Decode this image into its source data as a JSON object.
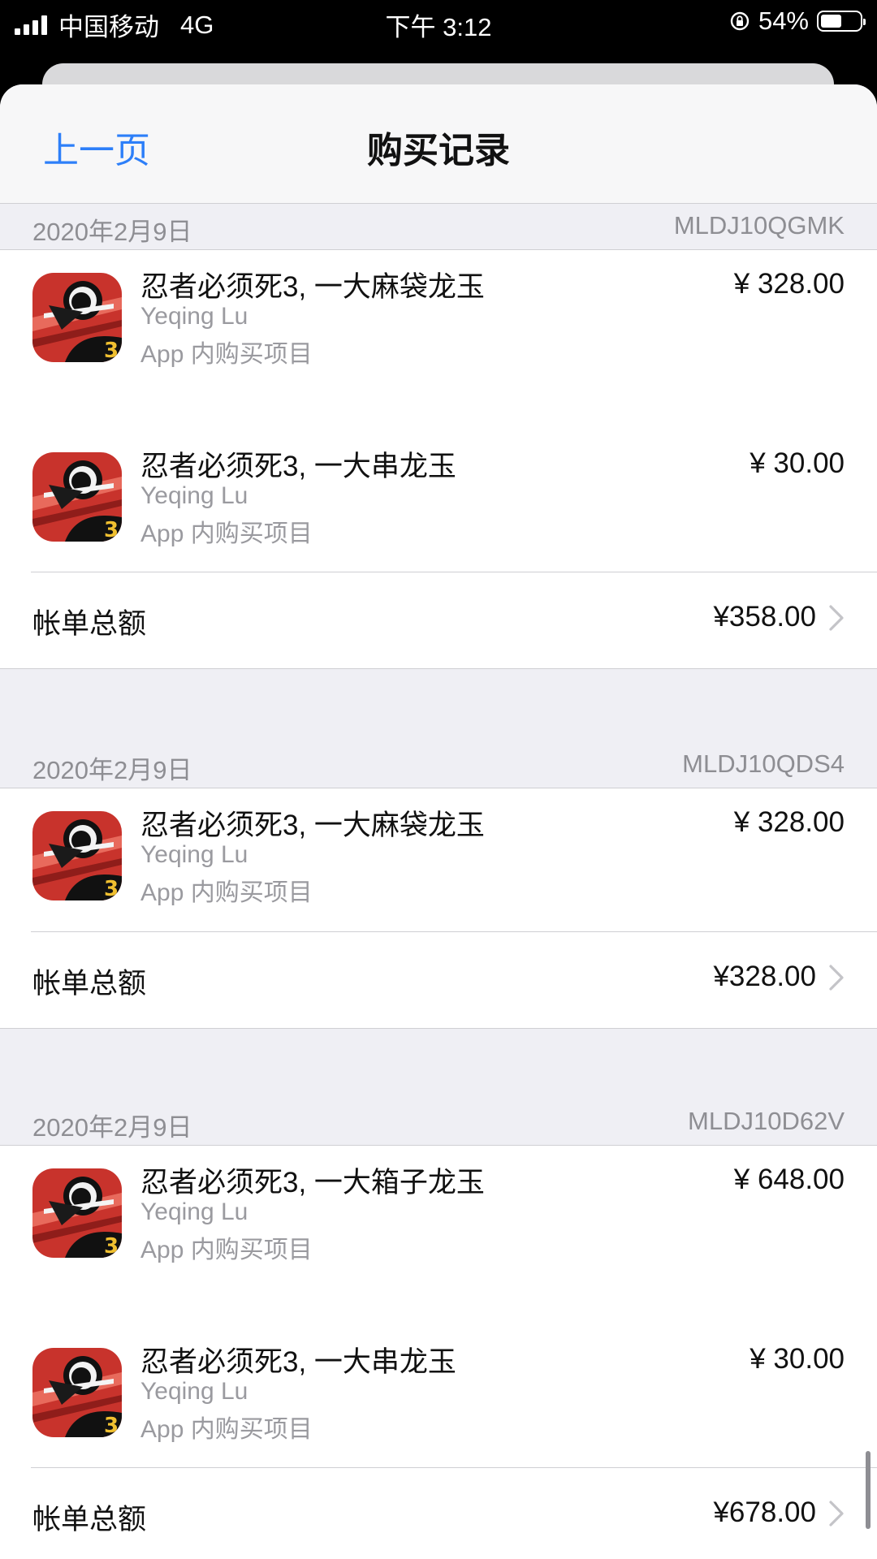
{
  "status_bar": {
    "carrier": "中国移动",
    "network": "4G",
    "time": "下午 3:12",
    "battery": "54%",
    "battery_level": 0.54
  },
  "nav": {
    "back": "上一页",
    "title": "购买记录"
  },
  "colors": {
    "accent": "#2d7ff9",
    "secondary_text": "#8e8e93",
    "background": "#efeff4"
  },
  "groups": [
    {
      "date": "2020年2月9日",
      "order_id": "MLDJ10QGMK",
      "items": [
        {
          "title": "忍者必须死3, 一大麻袋龙玉",
          "developer": "Yeqing Lu",
          "type": "App 内购买项目",
          "price": "¥ 328.00"
        },
        {
          "title": "忍者必须死3, 一大串龙玉",
          "developer": "Yeqing Lu",
          "type": "App 内购买项目",
          "price": "¥ 30.00"
        }
      ],
      "total_label": "帐单总额",
      "total": "¥358.00"
    },
    {
      "date": "2020年2月9日",
      "order_id": "MLDJ10QDS4",
      "items": [
        {
          "title": "忍者必须死3, 一大麻袋龙玉",
          "developer": "Yeqing Lu",
          "type": "App 内购买项目",
          "price": "¥ 328.00"
        }
      ],
      "total_label": "帐单总额",
      "total": "¥328.00"
    },
    {
      "date": "2020年2月9日",
      "order_id": "MLDJ10D62V",
      "items": [
        {
          "title": "忍者必须死3, 一大箱子龙玉",
          "developer": "Yeqing Lu",
          "type": "App 内购买项目",
          "price": "¥ 648.00"
        },
        {
          "title": "忍者必须死3, 一大串龙玉",
          "developer": "Yeqing Lu",
          "type": "App 内购买项目",
          "price": "¥ 30.00"
        }
      ],
      "total_label": "帐单总额",
      "total": "¥678.00"
    }
  ]
}
